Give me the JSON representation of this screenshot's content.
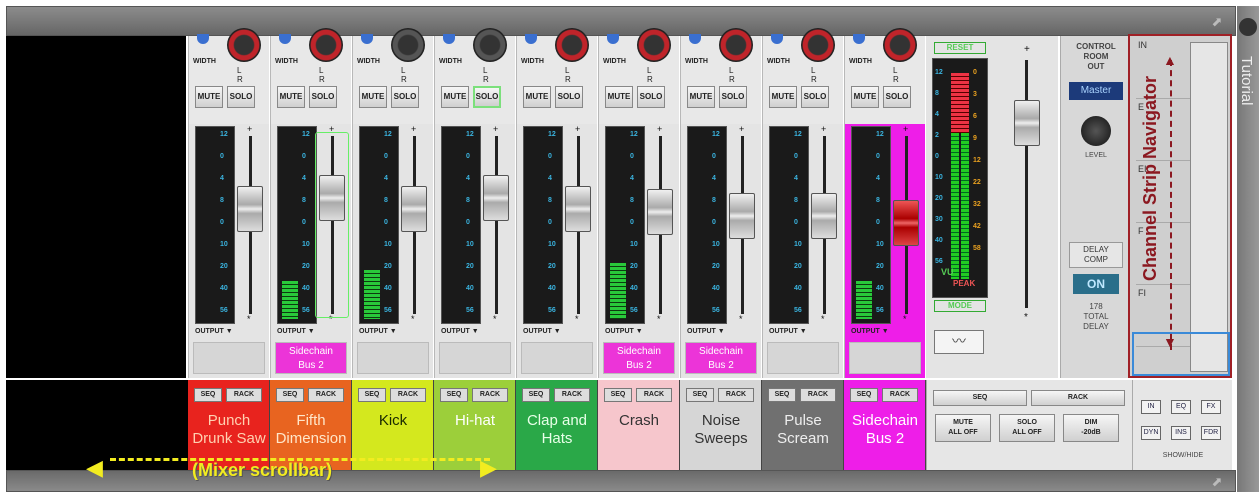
{
  "window": {
    "side_tab": "Tutorial"
  },
  "channel_controls": {
    "width_label": "WIDTH",
    "lr_label": "L R",
    "mute_label": "MUTE",
    "solo_label": "SOLO",
    "output_label": "OUTPUT"
  },
  "meter_scale": [
    "12",
    "0",
    "4",
    "8",
    "0",
    "10",
    "20",
    "40",
    "56"
  ],
  "channels": [
    {
      "name": "Punch\nDrunk Saw",
      "color": "#e8231e",
      "text_color": "#ffd0b0",
      "output": "",
      "level": 0.0,
      "fader": 0.72
    },
    {
      "name": "Fifth\nDimension",
      "color": "#e86420",
      "text_color": "#ffe6c8",
      "output": "Sidechain\nBus 2",
      "level": 0.2,
      "fader": 0.78
    },
    {
      "name": "Kick",
      "color": "#d4e81e",
      "text_color": "#1a2a00",
      "output": "",
      "level": 0.26,
      "fader": 0.72
    },
    {
      "name": "Hi-hat",
      "color": "#9ccf3a",
      "text_color": "#fff",
      "output": "",
      "level": 0.0,
      "fader": 0.78
    },
    {
      "name": "Clap and\nHats",
      "color": "#2aa848",
      "text_color": "#e8ffe8",
      "output": "",
      "level": 0.0,
      "fader": 0.72
    },
    {
      "name": "Crash",
      "color": "#f6c6cc",
      "text_color": "#333",
      "output": "Sidechain\nBus 2",
      "level": 0.3,
      "fader": 0.7
    },
    {
      "name": "Noise\nSweeps",
      "color": "#d6d6d6",
      "text_color": "#333",
      "output": "Sidechain\nBus 2",
      "level": 0.0,
      "fader": 0.68
    },
    {
      "name": "Pulse\nScream",
      "color": "#707070",
      "text_color": "#eee",
      "output": "",
      "level": 0.0,
      "fader": 0.68
    },
    {
      "name": "Sidechain\nBus 2",
      "color": "#ee1ee8",
      "text_color": "#fff",
      "output": "",
      "level": 0.2,
      "fader": 0.64
    }
  ],
  "strip_buttons": {
    "seq": "SEQ",
    "rack": "RACK"
  },
  "master": {
    "reset": "RESET",
    "vu": "VU",
    "peak": "PEAK",
    "mode": "MODE",
    "meter_scale": [
      "12",
      "8",
      "4",
      "2",
      "0",
      "10",
      "20",
      "30",
      "40",
      "56"
    ],
    "meter_scale_right": [
      "0",
      "3",
      "6",
      "9",
      "12",
      "22",
      "32",
      "42",
      "58"
    ]
  },
  "control_room": {
    "label": "CONTROL\nROOM\nOUT",
    "output": "Master",
    "level": "LEVEL",
    "delay_comp": "DELAY\nCOMP",
    "on": "ON",
    "delay_value": "178",
    "total_delay": "TOTAL\nDELAY"
  },
  "navigator": {
    "title": "Channel Strip Navigator",
    "rows": [
      "IN",
      "E",
      "EI",
      "F",
      "FI"
    ]
  },
  "master_strip": {
    "seq": "SEQ",
    "rack": "RACK",
    "mute_all": "MUTE\nALL OFF",
    "solo_all": "SOLO\nALL OFF",
    "dim": "DIM\n-20dB"
  },
  "show_hide": {
    "buttons": [
      "IN",
      "EQ",
      "FX",
      "DYN",
      "INS",
      "FDR"
    ],
    "label": "SHOW/HIDE"
  },
  "annotation": {
    "scrollbar": "(Mixer scrollbar)"
  }
}
